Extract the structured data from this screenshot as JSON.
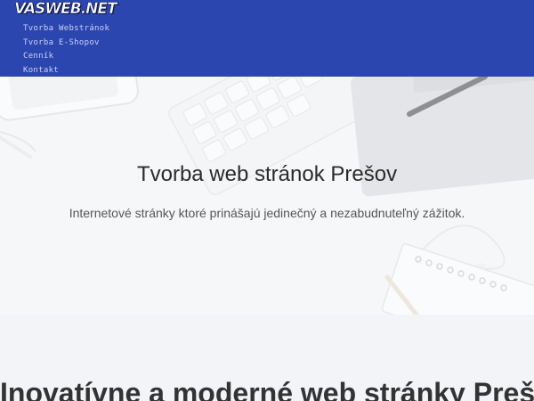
{
  "header": {
    "logo_text": "VASWEB.NET",
    "background_color": "#2c46b0",
    "nav": [
      {
        "label": "Tvorba Webstránok"
      },
      {
        "label": "Tvorba E-Shopov"
      },
      {
        "label": "Cenník"
      },
      {
        "label": "Kontakt"
      }
    ]
  },
  "hero": {
    "title": "Tvorba web stránok Prešov",
    "subtitle": "Internetové stránky ktoré prinášajú jedinečný a nezabudnuteľný zážitok."
  },
  "section": {
    "title": "Inovatívne a moderné web stránky Prešov"
  }
}
